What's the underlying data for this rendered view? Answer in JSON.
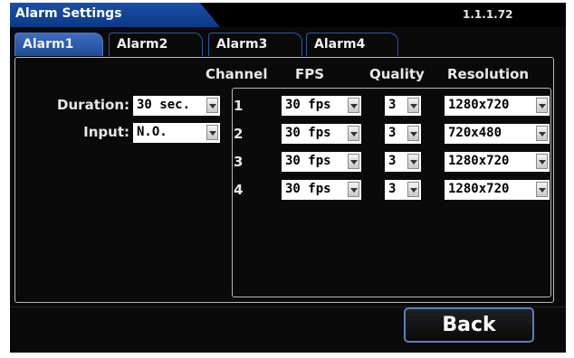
{
  "title": "Alarm Settings",
  "version": "1.1.1.72",
  "tabs": [
    {
      "label": "Alarm1",
      "active": true
    },
    {
      "label": "Alarm2",
      "active": false
    },
    {
      "label": "Alarm3",
      "active": false
    },
    {
      "label": "Alarm4",
      "active": false
    }
  ],
  "left": {
    "duration_label": "Duration:",
    "duration_value": "30 sec.",
    "input_label": "Input:",
    "input_value": "N.O."
  },
  "table": {
    "headers": [
      "Channel",
      "FPS",
      "Quality",
      "Resolution"
    ],
    "rows": [
      {
        "channel": "1",
        "fps": "30 fps",
        "quality": "3",
        "resolution": "1280x720"
      },
      {
        "channel": "2",
        "fps": "30 fps",
        "quality": "3",
        "resolution": "720x480"
      },
      {
        "channel": "3",
        "fps": "30 fps",
        "quality": "3",
        "resolution": "1280x720"
      },
      {
        "channel": "4",
        "fps": "30 fps",
        "quality": "3",
        "resolution": "1280x720"
      }
    ]
  },
  "back_label": "Back",
  "colors": {
    "accent": "#1a4fa8",
    "border": "#5a7fc0",
    "background": "#0a0a0a"
  }
}
